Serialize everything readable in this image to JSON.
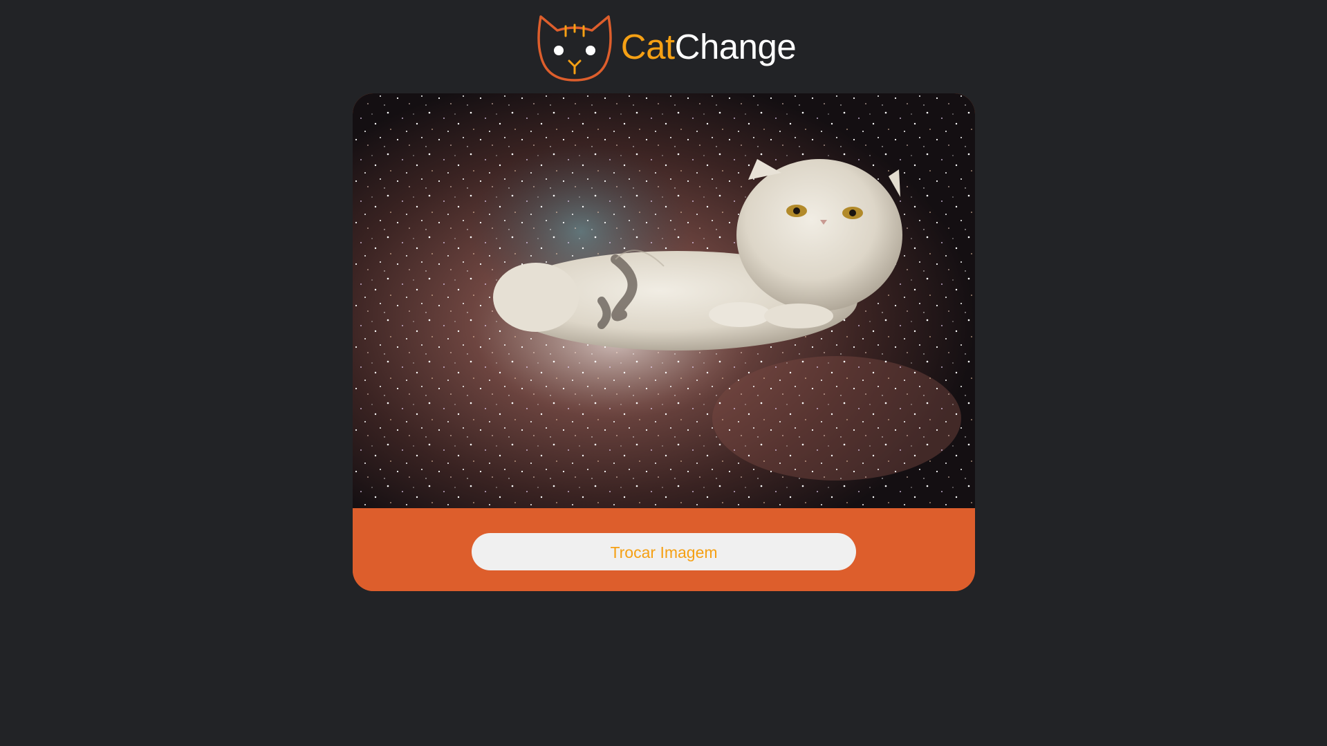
{
  "header": {
    "logo_icon": "cat-face-icon",
    "brand_part1": "Cat",
    "brand_part2": "Change"
  },
  "card": {
    "image_description_icon": "cat-in-space-photo",
    "button_label": "Trocar Imagem"
  },
  "colors": {
    "background": "#222326",
    "accent_orange": "#f5a014",
    "card_orange": "#dd5e2c",
    "button_bg": "#f0f0f0",
    "logo_stroke": "#dd5e2c"
  }
}
